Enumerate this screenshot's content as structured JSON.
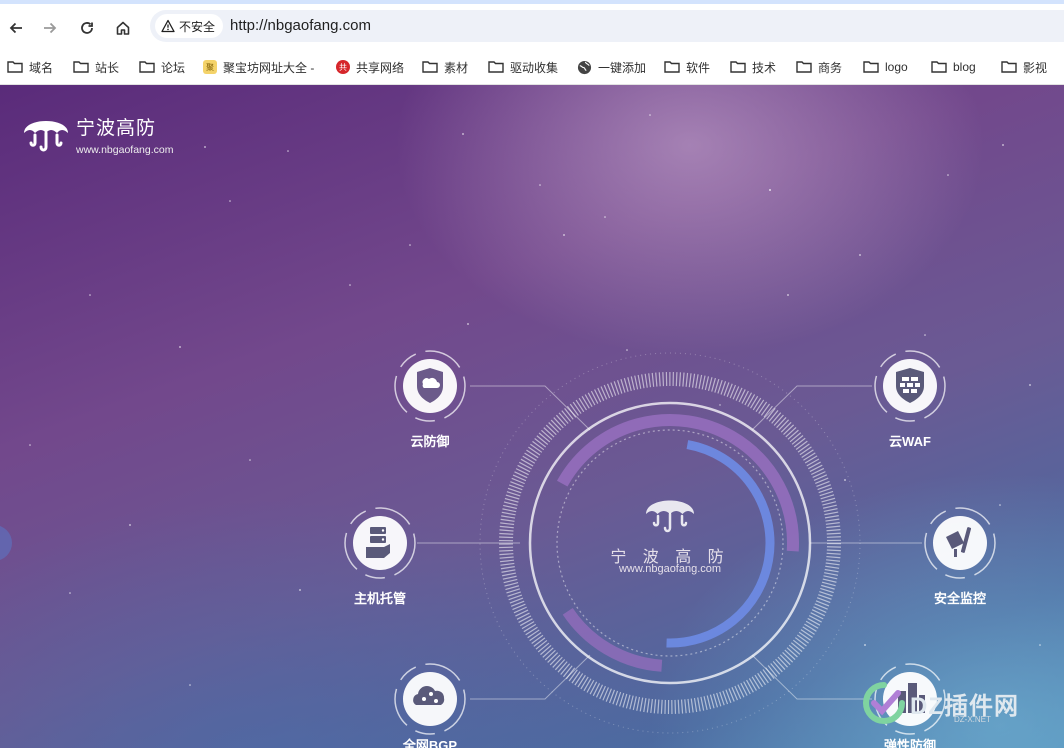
{
  "browser": {
    "security_label": "不安全",
    "url": "http://nbgaofang.com"
  },
  "bookmarks": [
    {
      "label": "域名",
      "icon": "folder-icon"
    },
    {
      "label": "站长",
      "icon": "folder-icon"
    },
    {
      "label": "论坛",
      "icon": "folder-icon"
    },
    {
      "label": "聚宝坊网址大全 -",
      "icon": "site-favicon"
    },
    {
      "label": "共享网络",
      "icon": "site-favicon"
    },
    {
      "label": "素材",
      "icon": "folder-icon"
    },
    {
      "label": "驱动收集",
      "icon": "folder-icon"
    },
    {
      "label": "一键添加",
      "icon": "globe-icon"
    },
    {
      "label": "软件",
      "icon": "folder-icon"
    },
    {
      "label": "技术",
      "icon": "folder-icon"
    },
    {
      "label": "商务",
      "icon": "folder-icon"
    },
    {
      "label": "logo",
      "icon": "folder-icon"
    },
    {
      "label": "blog",
      "icon": "folder-icon"
    },
    {
      "label": "影视",
      "icon": "folder-icon"
    }
  ],
  "site": {
    "logo_title": "宁波高防",
    "logo_url": "www.nbgaofang.com",
    "center_title": "宁 波 高 防",
    "center_url": "www.nbgaofang.com"
  },
  "features": [
    {
      "label": "云防御",
      "icon": "cloud-shield-icon"
    },
    {
      "label": "云WAF",
      "icon": "firewall-icon"
    },
    {
      "label": "主机托管",
      "icon": "server-icon"
    },
    {
      "label": "安全监控",
      "icon": "monitor-camera-icon"
    },
    {
      "label": "全网BGP",
      "icon": "cloud-network-icon"
    },
    {
      "label": "弹性防御",
      "icon": "buildings-icon"
    }
  ],
  "watermark": {
    "text": "DZ插件网",
    "sub": "DZ-X.NET"
  }
}
